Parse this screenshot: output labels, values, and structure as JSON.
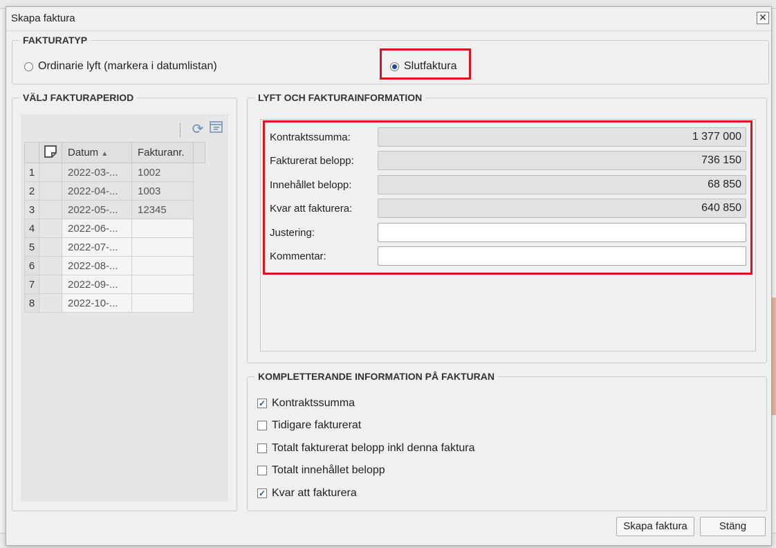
{
  "dialog": {
    "title": "Skapa faktura",
    "close": "✕"
  },
  "fakturatyp": {
    "legend": "FAKTURATYP",
    "ordinarie_label": "Ordinarie lyft (markera i datumlistan)",
    "slutfaktura_label": "Slutfaktura",
    "selected": "Slutfaktura"
  },
  "period": {
    "legend": "VÄLJ FAKTURAPERIOD",
    "columns": [
      "",
      "",
      "Datum",
      "Fakturanr."
    ],
    "rows": [
      {
        "n": "1",
        "datum": "2022-03-...",
        "faktura": "1002"
      },
      {
        "n": "2",
        "datum": "2022-04-...",
        "faktura": "1003"
      },
      {
        "n": "3",
        "datum": "2022-05-...",
        "faktura": "12345"
      },
      {
        "n": "4",
        "datum": "2022-06-...",
        "faktura": ""
      },
      {
        "n": "5",
        "datum": "2022-07-...",
        "faktura": ""
      },
      {
        "n": "6",
        "datum": "2022-08-...",
        "faktura": ""
      },
      {
        "n": "7",
        "datum": "2022-09-...",
        "faktura": ""
      },
      {
        "n": "8",
        "datum": "2022-10-...",
        "faktura": ""
      }
    ]
  },
  "lyft": {
    "legend": "LYFT OCH FAKTURAINFORMATION",
    "kontraktssumma_label": "Kontraktssumma:",
    "kontraktssumma_value": "1 377 000",
    "fakturerat_label": "Fakturerat belopp:",
    "fakturerat_value": "736 150",
    "innehallet_label": "Innehållet belopp:",
    "innehallet_value": "68 850",
    "kvar_label": "Kvar att fakturera:",
    "kvar_value": "640 850",
    "justering_label": "Justering:",
    "justering_value": "",
    "kommentar_label": "Kommentar:",
    "kommentar_value": ""
  },
  "komplett": {
    "legend": "KOMPLETTERANDE INFORMATION PÅ FAKTURAN",
    "items": [
      {
        "label": "Kontraktssumma",
        "checked": true
      },
      {
        "label": "Tidigare fakturerat",
        "checked": false
      },
      {
        "label": "Totalt fakturerat belopp inkl denna faktura",
        "checked": false
      },
      {
        "label": "Totalt innehållet belopp",
        "checked": false
      },
      {
        "label": "Kvar att fakturera",
        "checked": true
      }
    ]
  },
  "buttons": {
    "create": "Skapa faktura",
    "close": "Stäng"
  },
  "colors": {
    "highlight": "#e0101e",
    "accent": "#1f4f8f"
  },
  "icons": {
    "refresh": "refresh-icon",
    "export": "export-icon",
    "note": "note-icon",
    "sort": "sort-ascending-icon"
  }
}
